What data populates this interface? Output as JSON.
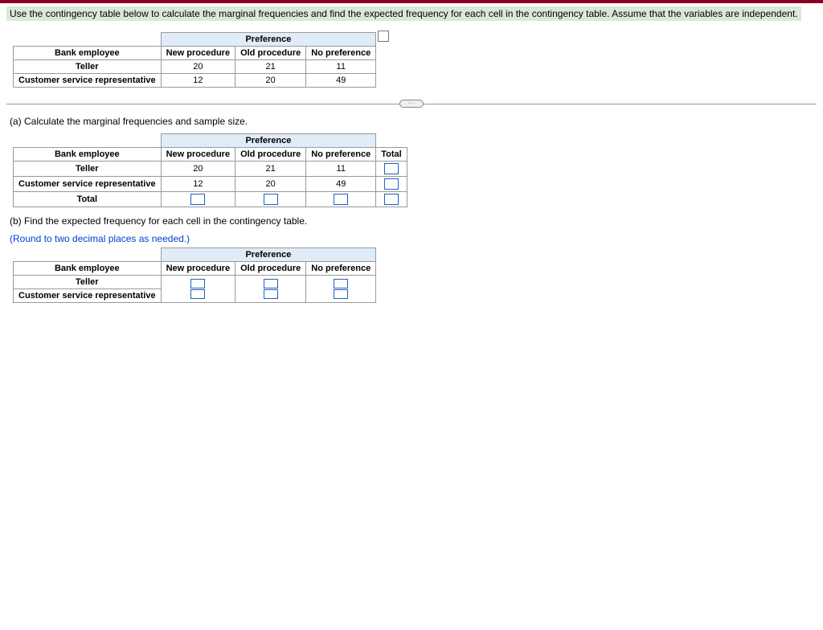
{
  "question": "Use the contingency table below to calculate the marginal frequencies and find the expected frequency for each cell in the contingency table. Assume that the variables are independent.",
  "col_group_label": "Preference",
  "row_header": "Bank employee",
  "cols": {
    "c1": "New procedure",
    "c2": "Old procedure",
    "c3": "No preference",
    "total": "Total"
  },
  "rows": {
    "r1": "Teller",
    "r2": "Customer service representative",
    "total": "Total"
  },
  "data": {
    "r1c1": "20",
    "r1c2": "21",
    "r1c3": "11",
    "r2c1": "12",
    "r2c2": "20",
    "r2c3": "49"
  },
  "partA": "(a) Calculate the marginal frequencies and sample size.",
  "partB": "(b) Find the expected frequency for each cell in the contingency table.",
  "roundNote": "(Round to two decimal places as needed.)",
  "handle": "····"
}
